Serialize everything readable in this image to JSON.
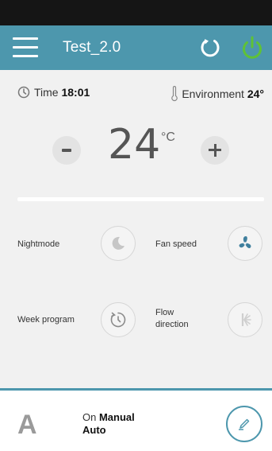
{
  "header": {
    "title": "Test_2.0",
    "menu_icon": "hamburger-menu-icon",
    "refresh_icon": "refresh-icon",
    "power_icon": "power-icon",
    "accent_color": "#4d97ad",
    "power_color": "#5fc236"
  },
  "info": {
    "time_label": "Time",
    "time_value": "18:01",
    "environment_label": "Environment",
    "environment_value": "24°"
  },
  "thermostat": {
    "temperature": "24",
    "unit": "°C"
  },
  "functions": {
    "nightmode": "Nightmode",
    "fan_speed": "Fan speed",
    "week_program": "Week program",
    "flow_direction": "Flow direction"
  },
  "footer": {
    "mode_letter": "A",
    "status_on": "On",
    "status_manual": "Manual",
    "status_auto": "Auto"
  }
}
